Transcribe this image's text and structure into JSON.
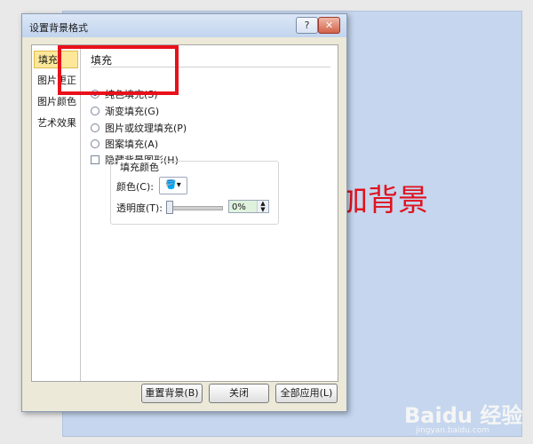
{
  "slide": {
    "title_text": "加背景"
  },
  "dialog": {
    "title": "设置背景格式",
    "help_glyph": "?",
    "close_glyph": "✕",
    "sidebar": [
      "填充",
      "图片更正",
      "图片颜色",
      "艺术效果"
    ],
    "section_title": "填充",
    "options": [
      {
        "label": "纯色填充(S)",
        "selected": true
      },
      {
        "label": "渐变填充(G)",
        "selected": false
      },
      {
        "label": "图片或纹理填充(P)",
        "selected": false
      },
      {
        "label": "图案填充(A)",
        "selected": false
      }
    ],
    "hide_bg_checkbox": "隐藏背景图形(H)",
    "fill_color_group": {
      "title": "填充颜色",
      "color_label": "颜色(C):",
      "transparency_label": "透明度(T):",
      "transparency_value": "0%",
      "transparency_level": 0
    },
    "buttons": {
      "reset": "重置背景(B)",
      "close": "关闭",
      "apply_all": "全部应用(L)"
    }
  },
  "watermark": {
    "brand": "Baidu 经验",
    "url": "jingyan.baidu.com"
  },
  "colors": {
    "highlight": "#e8101a",
    "slide_bg": "#c5d6ee",
    "slide_text": "#e0121e"
  }
}
